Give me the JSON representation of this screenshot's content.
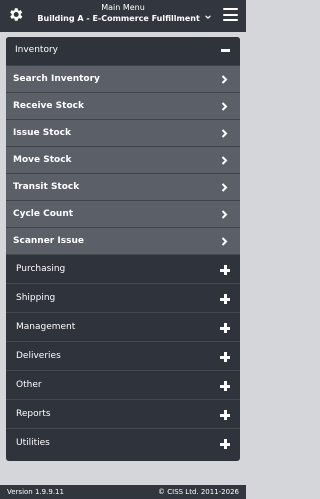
{
  "header": {
    "title": "Main Menu",
    "location": "Building A - E-Commerce Fulfillment",
    "left_icon": "gear-icon",
    "right_icon": "hamburger-menu-icon"
  },
  "inventory": {
    "label": "Inventory",
    "items": [
      {
        "label": "Search Inventory"
      },
      {
        "label": "Receive Stock"
      },
      {
        "label": "Issue Stock"
      },
      {
        "label": "Move Stock"
      },
      {
        "label": "Transit Stock"
      },
      {
        "label": "Cycle Count"
      },
      {
        "label": "Scanner Issue"
      }
    ]
  },
  "categories": [
    {
      "label": "Purchasing"
    },
    {
      "label": "Shipping"
    },
    {
      "label": "Management"
    },
    {
      "label": "Deliveries"
    },
    {
      "label": "Other"
    },
    {
      "label": "Reports"
    },
    {
      "label": "Utilities"
    }
  ],
  "footer": {
    "version": "Version 1.9.9.11",
    "copyright": "© CISS Ltd. 2011-2026"
  },
  "colors": {
    "topbar": "#32363e",
    "panel": "#2f333b",
    "subitem": "#5a5f68",
    "page_bg": "#d4d6d9"
  }
}
